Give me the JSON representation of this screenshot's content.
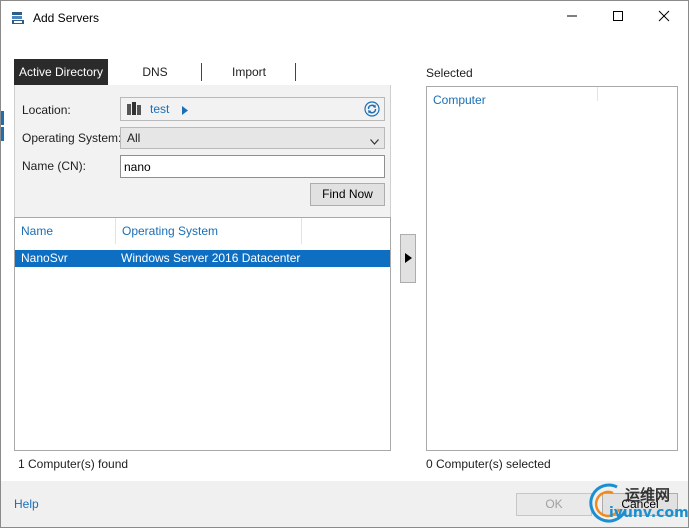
{
  "window": {
    "title": "Add Servers"
  },
  "tabs": [
    {
      "label": "Active Directory",
      "active": true
    },
    {
      "label": "DNS",
      "active": false
    },
    {
      "label": "Import",
      "active": false
    }
  ],
  "ad_search": {
    "location_label": "Location:",
    "location_value": "test",
    "os_label": "Operating System:",
    "os_value": "All",
    "name_label": "Name (CN):",
    "name_value": "nano",
    "find_button": "Find Now"
  },
  "results": {
    "columns": [
      "Name",
      "Operating System"
    ],
    "rows": [
      {
        "name": "NanoSvr",
        "os": "Windows Server 2016 Datacenter",
        "selected": true
      }
    ],
    "status": "1 Computer(s) found"
  },
  "selected_panel": {
    "label": "Selected",
    "column": "Computer",
    "status": "0 Computer(s) selected"
  },
  "footer": {
    "help": "Help",
    "ok": "OK",
    "cancel": "Cancel"
  },
  "watermark": {
    "line1": "运维网",
    "line2": "iyunv.com"
  },
  "colors": {
    "accent": "#1a6fb5",
    "selection": "#0e6fc2",
    "active_tab": "#2b2b2b"
  }
}
